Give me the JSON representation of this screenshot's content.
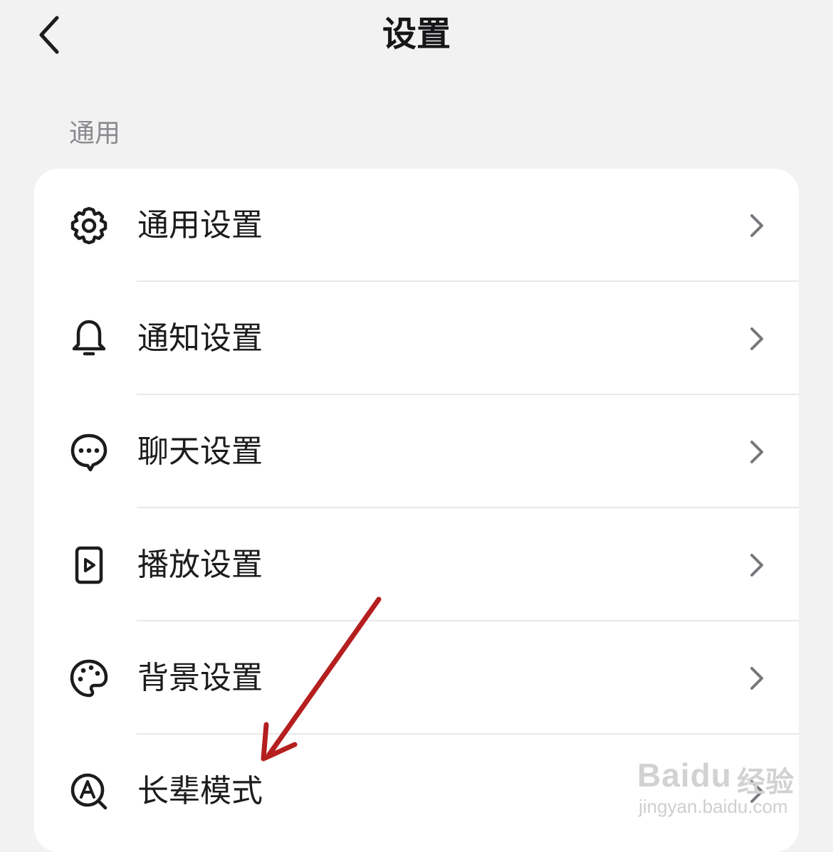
{
  "header": {
    "title": "设置"
  },
  "section": {
    "label": "通用"
  },
  "items": [
    {
      "label": "通用设置",
      "icon": "gear-icon"
    },
    {
      "label": "通知设置",
      "icon": "bell-icon"
    },
    {
      "label": "聊天设置",
      "icon": "chat-bubble-icon"
    },
    {
      "label": "播放设置",
      "icon": "play-icon"
    },
    {
      "label": "背景设置",
      "icon": "palette-icon"
    },
    {
      "label": "长辈模式",
      "icon": "elder-mode-icon"
    }
  ],
  "watermark": {
    "logo": "Baidu",
    "cn": "经验",
    "url": "jingyan.baidu.com"
  },
  "colors": {
    "background": "#f2f2f3",
    "card": "#ffffff",
    "annotation_arrow": "#b51f1f",
    "chevron": "#77777b"
  }
}
